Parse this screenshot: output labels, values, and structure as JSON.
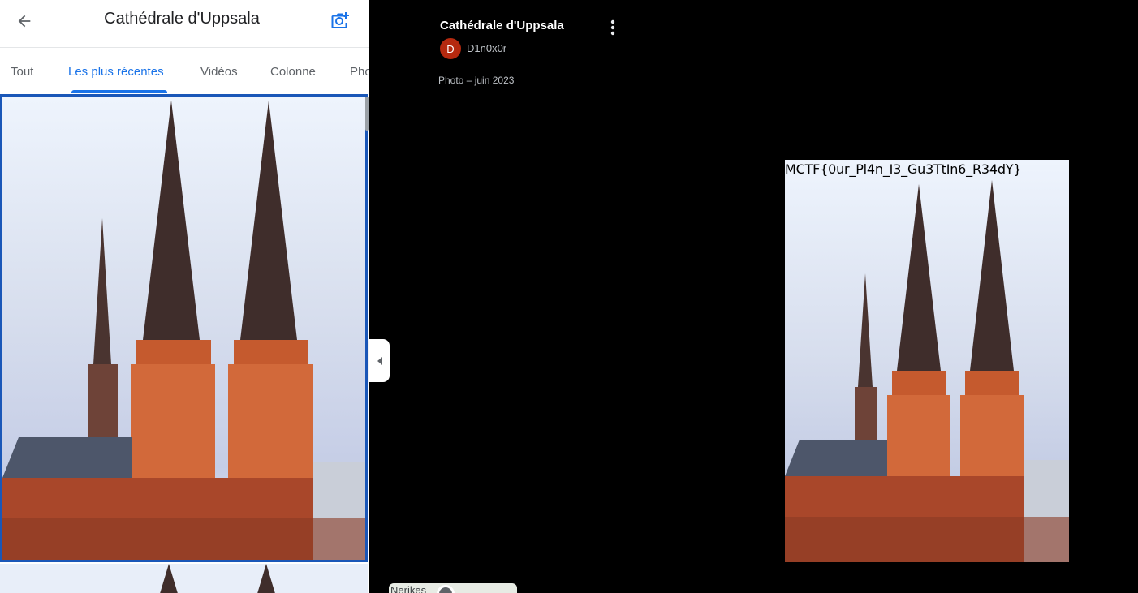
{
  "header": {
    "title": "Cathédrale d'Uppsala",
    "back_icon": "arrow-left-icon",
    "add_photo_icon": "camera-plus-icon"
  },
  "tabs": [
    {
      "label": "Tout",
      "active": false
    },
    {
      "label": "Les plus récentes",
      "active": true
    },
    {
      "label": "Vidéos",
      "active": false
    },
    {
      "label": "Colonne",
      "active": false
    },
    {
      "label": "Pho",
      "active": false
    }
  ],
  "viewer": {
    "title": "Cathédrale d'Uppsala",
    "author_initial": "D",
    "author_name": "D1n0x0r",
    "meta": "Photo – juin 2023",
    "image_overlay_text": "MCTF{0ur_Pl4n_I3_Gu3TtIn6_R34dY}"
  },
  "minimap": {
    "label": "Nerikes"
  },
  "colors": {
    "accent": "#1a73e8",
    "selected_border": "#1a57b8",
    "avatar": "#b5290f",
    "viewer_bg": "#000000"
  }
}
